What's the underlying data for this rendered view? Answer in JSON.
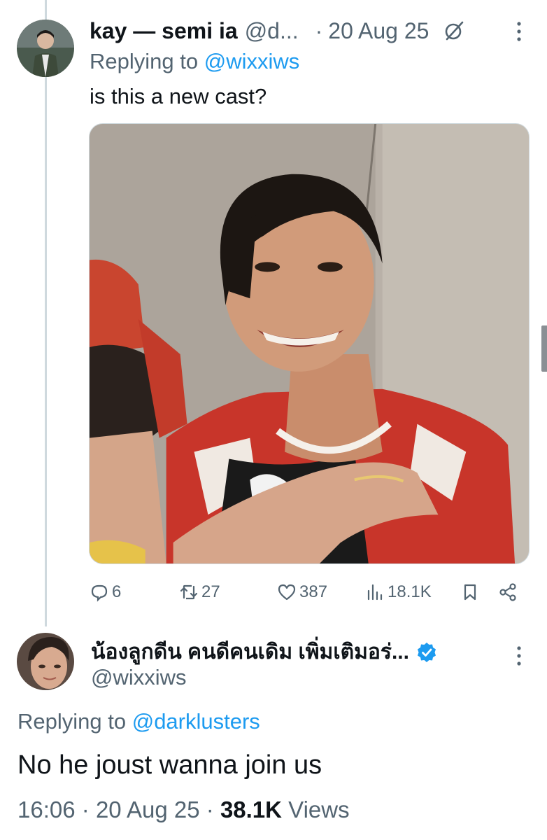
{
  "reply_tweet": {
    "author_name": "kay — semi ia",
    "author_handle": "@d...",
    "separator": "·",
    "date": "20 Aug 25",
    "replying_prefix": "Replying to",
    "replying_to": "@wixxiws",
    "text": "is this a new cast?",
    "media_icon": "photo",
    "actions": {
      "replies": "6",
      "retweets": "27",
      "likes": "387",
      "views": "18.1K"
    }
  },
  "main_tweet": {
    "author_name": "น้องลูกดีน คนดีคนเดิม เพิ่มเติมอร่...",
    "author_handle": "@wixxiws",
    "verified": true,
    "replying_prefix": "Replying to",
    "replying_to": "@darklusters",
    "text": "No he joust wanna join us",
    "time": "16:06",
    "separator1": "·",
    "date": "20 Aug 25",
    "separator2": "·",
    "views_count": "38.1K",
    "views_label": "Views"
  },
  "icons": [
    "grok-icon",
    "more-icon",
    "reply-icon",
    "retweet-icon",
    "like-icon",
    "views-icon",
    "bookmark-icon",
    "share-icon",
    "verified-icon"
  ],
  "colors": {
    "accent": "#1d9bf0",
    "text_primary": "#0f1419",
    "text_secondary": "#536471",
    "thread_line": "#cfd9de"
  }
}
